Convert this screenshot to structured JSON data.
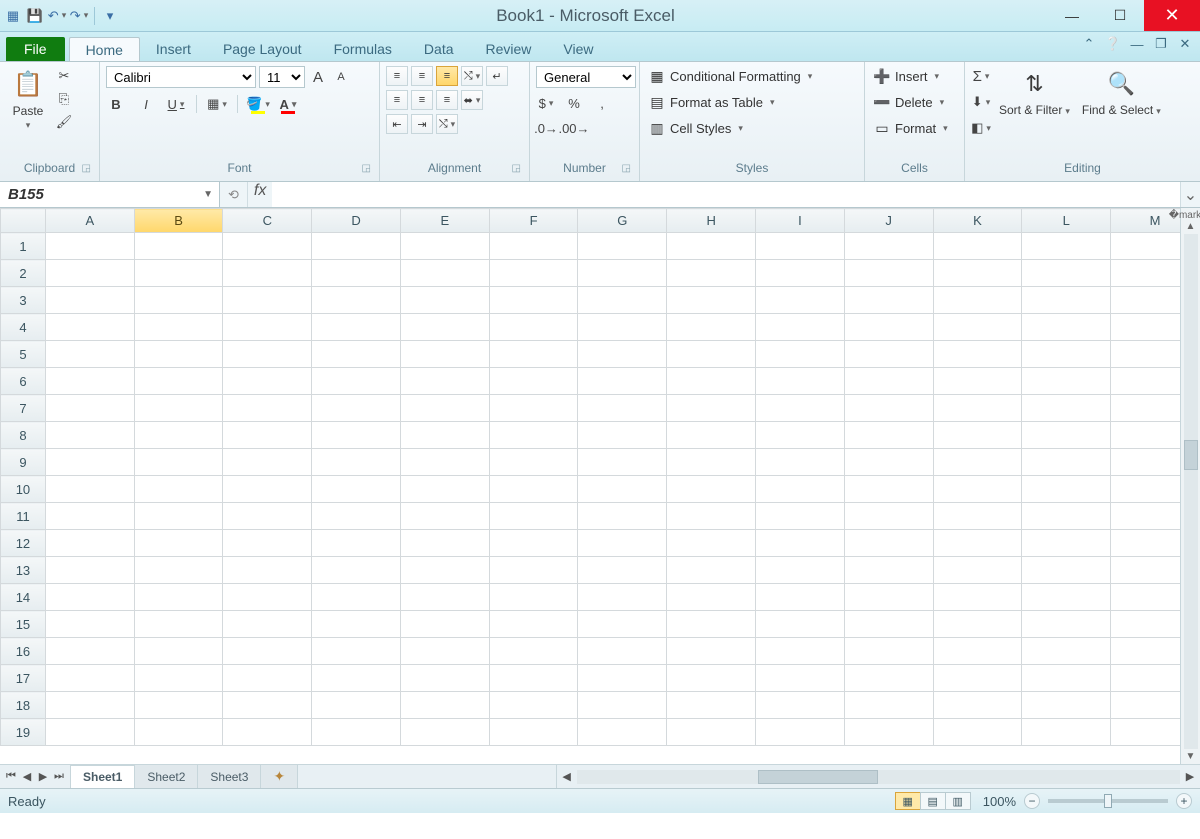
{
  "window": {
    "title": "Book1 - Microsoft Excel"
  },
  "qat": {
    "save": "💾",
    "undo": "↶",
    "redo": "↷"
  },
  "tabs": {
    "file": "File",
    "items": [
      "Home",
      "Insert",
      "Page Layout",
      "Formulas",
      "Data",
      "Review",
      "View"
    ],
    "active": "Home"
  },
  "ribbon": {
    "clipboard": {
      "label": "Clipboard",
      "paste": "Paste"
    },
    "font": {
      "label": "Font",
      "name": "Calibri",
      "size": "11",
      "bold": "B",
      "italic": "I",
      "underline": "U"
    },
    "alignment": {
      "label": "Alignment"
    },
    "number": {
      "label": "Number",
      "format": "General",
      "currency": "$",
      "percent": "%",
      "comma": ",",
      "inc": ".0←.00",
      "dec": ".00→.0"
    },
    "styles": {
      "label": "Styles",
      "cond": "Conditional Formatting",
      "table": "Format as Table",
      "cell": "Cell Styles"
    },
    "cells": {
      "label": "Cells",
      "insert": "Insert",
      "delete": "Delete",
      "format": "Format"
    },
    "editing": {
      "label": "Editing",
      "sort": "Sort & Filter",
      "find": "Find & Select"
    }
  },
  "namebox": {
    "value": "B155"
  },
  "formula": {
    "fx": "fx",
    "value": ""
  },
  "columns": [
    "A",
    "B",
    "C",
    "D",
    "E",
    "F",
    "G",
    "H",
    "I",
    "J",
    "K",
    "L",
    "M"
  ],
  "selected_column": "B",
  "rows": [
    1,
    2,
    3,
    4,
    5,
    6,
    7,
    8,
    9,
    10,
    11,
    12,
    13,
    14,
    15,
    16,
    17,
    18,
    19
  ],
  "sheets": {
    "items": [
      "Sheet1",
      "Sheet2",
      "Sheet3"
    ],
    "active": "Sheet1"
  },
  "status": {
    "ready": "Ready",
    "zoom": "100%"
  }
}
